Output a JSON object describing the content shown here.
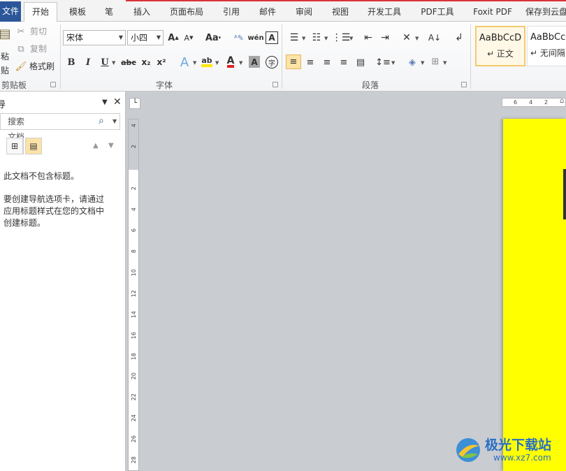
{
  "tabs": {
    "file": "文件",
    "items": [
      "开始",
      "模板",
      "笔",
      "插入",
      "页面布局",
      "引用",
      "邮件",
      "审阅",
      "视图",
      "开发工具",
      "PDF工具",
      "Foxit PDF",
      "保存到云盘"
    ],
    "active": "开始"
  },
  "clipboard": {
    "paste": "粘贴",
    "cut": "剪切",
    "copy": "复制",
    "format_painter": "格式刷",
    "label": "剪贴板"
  },
  "font": {
    "name": "宋体",
    "size": "小四",
    "label": "字体",
    "bold": "B",
    "italic": "I",
    "underline": "U",
    "strike": "abc",
    "subscript": "x₂",
    "superscript": "x²",
    "grow": "A",
    "shrink": "A",
    "case": "Aa",
    "clear": "A",
    "char_border": "A"
  },
  "paragraph": {
    "label": "段落"
  },
  "styles": {
    "items": [
      {
        "sample": "AaBbCcD",
        "name": "↵ 正文"
      },
      {
        "sample": "AaBbCcD",
        "name": "↵ 无间隔"
      }
    ]
  },
  "nav": {
    "title": "导航",
    "search_placeholder": "搜索文档",
    "no_headings": "此文档不包含标题。",
    "help": "要创建导航选项卡，请通过应用标题样式在您的文档中创建标题。"
  },
  "ruler": {
    "vertical": [
      "4",
      "2",
      "2",
      "4",
      "6",
      "8",
      "10",
      "12",
      "14",
      "16",
      "18",
      "20",
      "22",
      "24",
      "26",
      "28"
    ],
    "horizontal": [
      "6",
      "4",
      "2"
    ]
  },
  "watermark": {
    "brand": "极光下载站",
    "url": "www.xz7.com"
  },
  "colors": {
    "file_tab": "#2b579a",
    "page": "#ffff00",
    "highlight": "#ffe800",
    "font_color": "#e02020"
  }
}
